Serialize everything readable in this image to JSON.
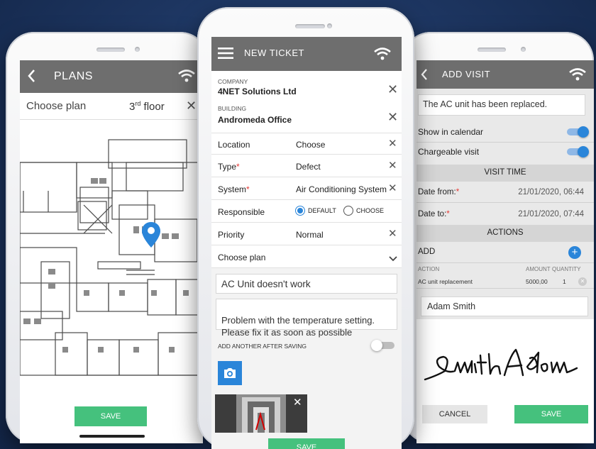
{
  "plans": {
    "title": "PLANS",
    "choose_label": "Choose plan",
    "floor_num": "3",
    "floor_sup": "rd",
    "floor_word": "floor",
    "save": "SAVE"
  },
  "ticket": {
    "title": "NEW TICKET",
    "company_label": "COMPANY",
    "company_value": "4NET Solutions Ltd",
    "building_label": "BUILDING",
    "building_value": "Andromeda Office",
    "rows": [
      {
        "label": "Location",
        "value": "Choose",
        "required": false
      },
      {
        "label": "Type",
        "value": "Defect",
        "required": true
      },
      {
        "label": "System",
        "value": "Air Conditioning System",
        "required": true
      },
      {
        "label": "Responsible",
        "value": "",
        "required": false
      },
      {
        "label": "Priority",
        "value": "Normal",
        "required": false
      }
    ],
    "radio_default": "DEFAULT",
    "radio_choose": "CHOOSE",
    "choose_plan": "Choose plan",
    "subject": "AC Unit doesn't work",
    "description": "Problem with the temperature setting.\nPlease fix it as soon as possible",
    "add_another": "ADD ANOTHER AFTER SAVING",
    "save": "SAVE"
  },
  "visit": {
    "title": "ADD VISIT",
    "note": "The AC unit has been replaced.",
    "show_in_calendar": "Show in calendar",
    "chargeable_visit": "Chargeable visit",
    "visit_time": "VISIT TIME",
    "date_from_label": "Date from:",
    "date_from_value": "21/01/2020, 06:44",
    "date_to_label": "Date to:",
    "date_to_value": "21/01/2020, 07:44",
    "actions": "ACTIONS",
    "add": "ADD",
    "col_action": "ACTION",
    "col_amount": "AMOUNT",
    "col_quantity": "QUANTITY",
    "item_action": "AC unit replacement",
    "item_amount": "5000,00",
    "item_quantity": "1",
    "signer": "Adam Smith",
    "signature": "Smith Adam",
    "cancel": "CANCEL",
    "save": "SAVE"
  },
  "colors": {
    "accent_blue": "#2a85d9",
    "save_green": "#45c17d",
    "header_gray": "#6e6e6e",
    "required_red": "#e53935",
    "background_navy": "#1d3560"
  }
}
